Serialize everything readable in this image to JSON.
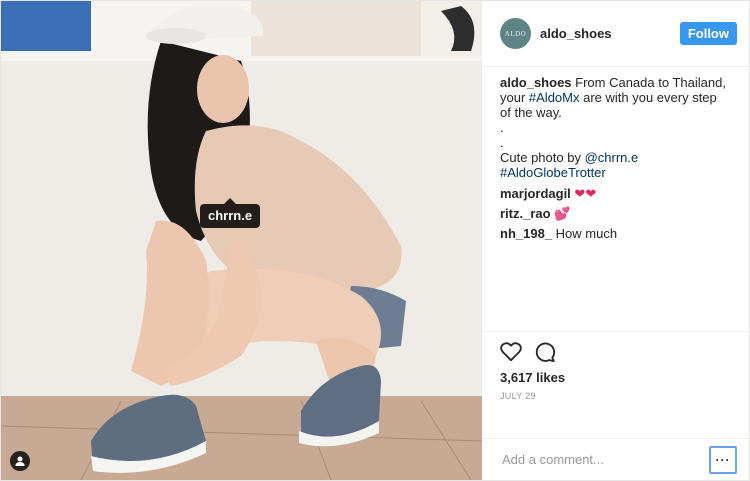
{
  "photo": {
    "tag_label": "chrrn.e",
    "tag_icon": "user-tag-icon"
  },
  "header": {
    "avatar_text": "ALDO",
    "username": "aldo_shoes",
    "follow_label": "Follow"
  },
  "caption": {
    "username": "aldo_shoes",
    "text_1": " From Canada to Thailand, your ",
    "hashtag_1": "#AldoMx",
    "text_2": " are with you every step of the way.",
    "dot_1": ".",
    "dot_2": ".",
    "text_3": "Cute photo by ",
    "mention": "@chrrn.e",
    "hashtag_2": "#AldoGlobeTrotter"
  },
  "comments": [
    {
      "username": "marjordagil",
      "text": "❤❤"
    },
    {
      "username": "ritz._rao",
      "text": "💕"
    },
    {
      "username": "nh_198_",
      "text": " How much"
    }
  ],
  "actions": {
    "like_icon": "heart-icon",
    "comment_icon": "comment-icon",
    "likes": "3,617 likes",
    "date": "JULY 29"
  },
  "add_comment": {
    "placeholder": "Add a comment...",
    "more_label": "···"
  }
}
